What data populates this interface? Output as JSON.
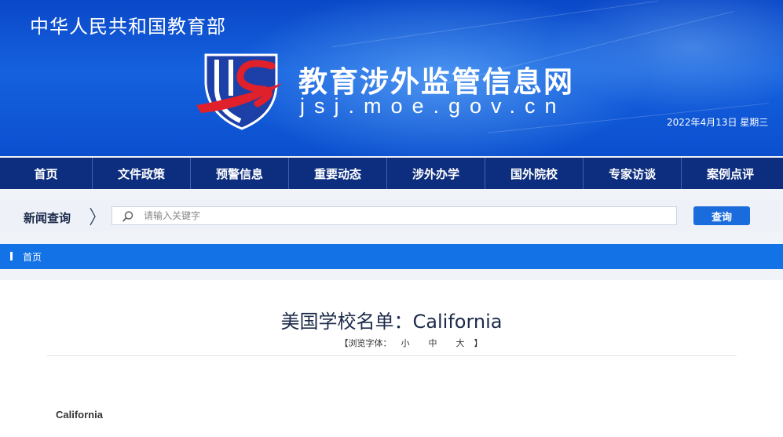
{
  "header": {
    "ministry": "中华人民共和国教育部",
    "site_title": "教育涉外监管信息网",
    "site_domain": "jsj.moe.gov.cn",
    "date": "2022年4月13日  星期三"
  },
  "nav": {
    "items": [
      "首页",
      "文件政策",
      "预警信息",
      "重要动态",
      "涉外办学",
      "国外院校",
      "专家访谈",
      "案例点评"
    ]
  },
  "search": {
    "label": "新闻查询",
    "placeholder": "请输入关键字",
    "value": "",
    "button_label": "查询"
  },
  "breadcrumb": {
    "home": "首页"
  },
  "article": {
    "title": "美国学校名单：California",
    "font_size": {
      "open": "【浏览字体：",
      "small": "小",
      "medium": "中",
      "large": "大",
      "close": "】"
    },
    "section_heading": "California"
  },
  "colors": {
    "banner_blue": "#1561de",
    "nav_bg": "#0d2e7e",
    "breadcrumb_bg": "#1272e6",
    "search_button": "#1a6cdc",
    "logo_red": "#e0202a"
  },
  "icons": [
    "moe-logo-icon",
    "search-icon",
    "chevron-right-icon"
  ]
}
